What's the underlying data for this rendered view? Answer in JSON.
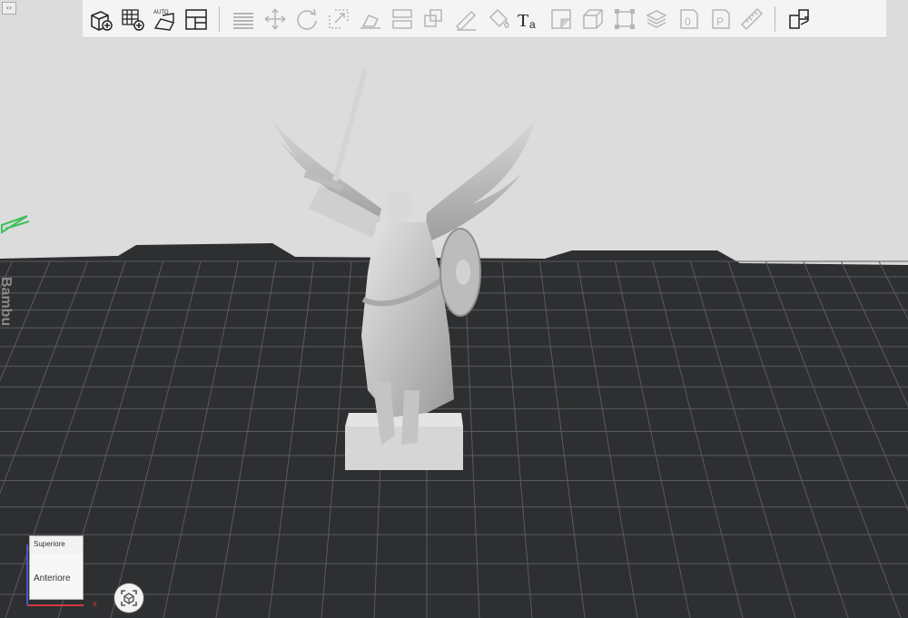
{
  "toolbar": {
    "items": [
      {
        "id": "add-model",
        "icon": "add-cube-icon",
        "enabled": true
      },
      {
        "id": "add-plate",
        "icon": "add-grid-icon",
        "enabled": true
      },
      {
        "id": "auto-arrange",
        "icon": "auto-arrange-icon",
        "label": "AUTO",
        "enabled": true
      },
      {
        "id": "layout",
        "icon": "layout-icon",
        "enabled": true
      },
      {
        "id": "layers",
        "icon": "layers-icon",
        "enabled": false
      },
      {
        "id": "move",
        "icon": "move-icon",
        "enabled": false
      },
      {
        "id": "rotate",
        "icon": "rotate-icon",
        "enabled": false
      },
      {
        "id": "scale",
        "icon": "scale-icon",
        "enabled": false
      },
      {
        "id": "lay-flat",
        "icon": "lay-flat-icon",
        "enabled": false
      },
      {
        "id": "cut",
        "icon": "cut-icon",
        "enabled": false
      },
      {
        "id": "boolean",
        "icon": "boolean-icon",
        "enabled": false
      },
      {
        "id": "support-paint",
        "icon": "support-paint-icon",
        "enabled": false
      },
      {
        "id": "color-paint",
        "icon": "paint-bucket-icon",
        "enabled": false
      },
      {
        "id": "text",
        "icon": "text-icon",
        "label": "Ta",
        "enabled": true
      },
      {
        "id": "measure-corner",
        "icon": "corner-icon",
        "enabled": false
      },
      {
        "id": "box",
        "icon": "box-icon",
        "enabled": false
      },
      {
        "id": "bounding",
        "icon": "bounding-box-icon",
        "enabled": false
      },
      {
        "id": "stack",
        "icon": "stack-icon",
        "enabled": false
      },
      {
        "id": "object-0",
        "icon": "object-0-icon",
        "label": "0",
        "enabled": false
      },
      {
        "id": "object-p",
        "icon": "object-p-icon",
        "label": "P",
        "enabled": false
      },
      {
        "id": "ruler",
        "icon": "ruler-icon",
        "enabled": false
      },
      {
        "id": "split-parts",
        "icon": "split-parts-icon",
        "enabled": true
      }
    ]
  },
  "collapse_toggle": {
    "label": "‹›"
  },
  "viewcube": {
    "top_label": "Superiore",
    "front_label": "Anteriore",
    "x_axis": "x"
  },
  "model": {
    "name": "angel-statue"
  },
  "plate": {
    "edge_text": "Bambu"
  },
  "colors": {
    "background": "#dcdcdc",
    "plate": "#2e2f31",
    "grid": "#5a5b5e",
    "model": "#c9c9c9",
    "toolbar": "#f4f4f4",
    "green_marker": "#3fbf5a"
  }
}
